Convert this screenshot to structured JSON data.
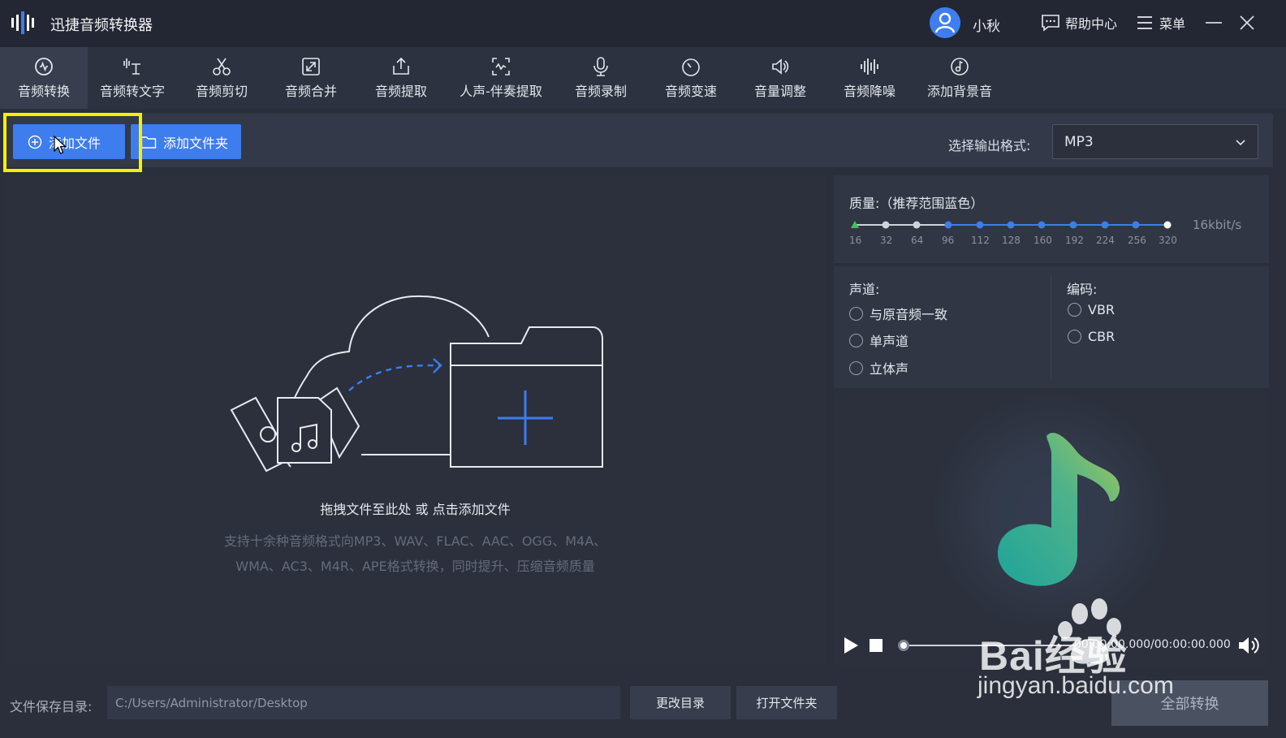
{
  "app": {
    "title": "迅捷音频转换器"
  },
  "header": {
    "username": "小秋",
    "help_label": "帮助中心",
    "menu_label": "菜单"
  },
  "tools": [
    {
      "label": "音频转换",
      "icon": "audio-convert-icon"
    },
    {
      "label": "音频转文字",
      "icon": "audio-to-text-icon"
    },
    {
      "label": "音频剪切",
      "icon": "scissors-icon"
    },
    {
      "label": "音频合并",
      "icon": "merge-icon"
    },
    {
      "label": "音频提取",
      "icon": "extract-icon"
    },
    {
      "label": "人声-伴奏提取",
      "icon": "vocal-extract-icon"
    },
    {
      "label": "音频录制",
      "icon": "microphone-icon"
    },
    {
      "label": "音频变速",
      "icon": "speed-icon"
    },
    {
      "label": "音量调整",
      "icon": "volume-adjust-icon"
    },
    {
      "label": "音频降噪",
      "icon": "denoise-icon"
    },
    {
      "label": "添加背景音",
      "icon": "background-music-icon"
    }
  ],
  "actions": {
    "add_file": "添加文件",
    "add_folder": "添加文件夹"
  },
  "output": {
    "label": "选择输出格式:",
    "format": "MP3"
  },
  "dropzone": {
    "main": "拖拽文件至此处 或 点击添加文件",
    "sub1": "支持十余种音频格式向MP3、WAV、FLAC、AAC、OGG、M4A、",
    "sub2": "WMA、AC3、M4R、APE格式转换，同时提升、压缩音频质量"
  },
  "quality": {
    "title": "质量:（推荐范围蓝色）",
    "ticks": [
      "16",
      "32",
      "64",
      "96",
      "112",
      "128",
      "160",
      "192",
      "224",
      "256",
      "320"
    ],
    "value_label": "16kbit/s"
  },
  "channel": {
    "title": "声道:",
    "options": [
      "与原音频一致",
      "单声道",
      "立体声"
    ]
  },
  "encoding": {
    "title": "编码:",
    "options": [
      "VBR",
      "CBR"
    ]
  },
  "player": {
    "time": "00:00:00.000/00:00:00.000"
  },
  "footer": {
    "save_label": "文件保存目录:",
    "save_path": "C:/Users/Administrator/Desktop",
    "change_dir": "更改目录",
    "open_folder": "打开文件夹",
    "convert_all": "全部转换"
  },
  "watermark": {
    "brand": "Bai经验",
    "site": "jingyan.baidu.com"
  },
  "colors": {
    "accent": "#3d7ded",
    "highlight": "#f6f000",
    "background": "#2a2f3b"
  }
}
